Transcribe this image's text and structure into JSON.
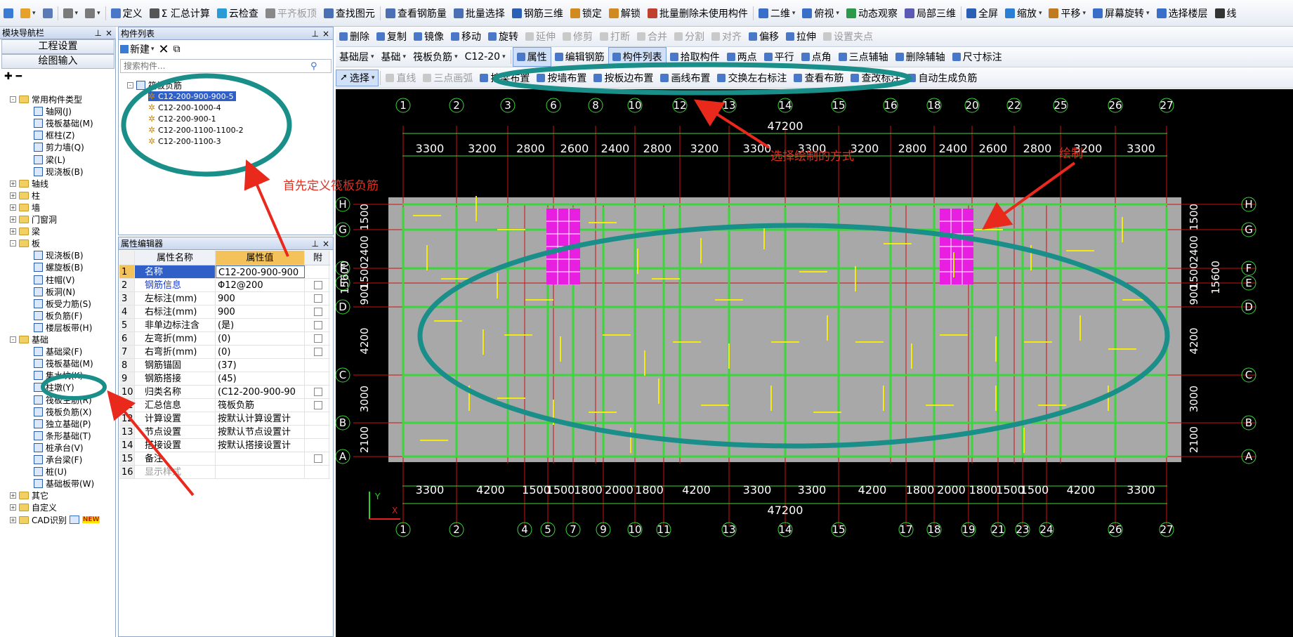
{
  "toolbar1": {
    "items": [
      {
        "icon": "new-icon",
        "label": ""
      },
      {
        "icon": "open-icon",
        "label": ""
      },
      {
        "icon": "save-icon",
        "label": ""
      },
      {
        "icon": "undo-icon",
        "label": ""
      },
      {
        "icon": "redo-icon",
        "label": ""
      },
      {
        "icon": "define-icon",
        "label": "定义"
      },
      {
        "icon": "sigma-icon",
        "label": "Σ 汇总计算"
      },
      {
        "icon": "cloud-icon",
        "label": "云检查"
      },
      {
        "icon": "align-slab-icon",
        "label": "平齐板顶"
      },
      {
        "icon": "find-icon",
        "label": "查找图元"
      },
      {
        "icon": "view-rebar-icon",
        "label": "查看钢筋量"
      },
      {
        "icon": "batch-select-icon",
        "label": "批量选择"
      },
      {
        "icon": "rebar-3d-icon",
        "label": "钢筋三维"
      },
      {
        "icon": "lock-icon",
        "label": "锁定"
      },
      {
        "icon": "unlock-icon",
        "label": "解锁"
      },
      {
        "icon": "batch-delete-icon",
        "label": "批量删除未使用构件"
      },
      {
        "icon": "2d-icon",
        "label": "二维"
      },
      {
        "icon": "top-view-icon",
        "label": "俯视"
      },
      {
        "icon": "dynamic-view-icon",
        "label": "动态观察"
      },
      {
        "icon": "local-3d-icon",
        "label": "局部三维"
      },
      {
        "icon": "fullscreen-icon",
        "label": "全屏"
      },
      {
        "icon": "zoom-icon",
        "label": "缩放"
      },
      {
        "icon": "pan-icon",
        "label": "平移"
      },
      {
        "icon": "rotate-screen-icon",
        "label": "屏幕旋转"
      },
      {
        "icon": "select-floor-icon",
        "label": "选择楼层"
      },
      {
        "icon": "line-icon",
        "label": "线"
      }
    ]
  },
  "nav": {
    "title": "模块导航栏",
    "pin": "ᵖ",
    "close": "×",
    "btn_project": "工程设置",
    "btn_draw": "绘图输入",
    "tree": [
      {
        "label": "常用构件类型",
        "level": 0,
        "expand": "-",
        "folder": true
      },
      {
        "label": "轴网(J)",
        "level": 1
      },
      {
        "label": "筏板基础(M)",
        "level": 1
      },
      {
        "label": "框柱(Z)",
        "level": 1
      },
      {
        "label": "剪力墙(Q)",
        "level": 1
      },
      {
        "label": "梁(L)",
        "level": 1
      },
      {
        "label": "现浇板(B)",
        "level": 1
      },
      {
        "label": "轴线",
        "level": 0,
        "expand": "+",
        "folder": true
      },
      {
        "label": "柱",
        "level": 0,
        "expand": "+",
        "folder": true
      },
      {
        "label": "墙",
        "level": 0,
        "expand": "+",
        "folder": true
      },
      {
        "label": "门窗洞",
        "level": 0,
        "expand": "+",
        "folder": true
      },
      {
        "label": "梁",
        "level": 0,
        "expand": "+",
        "folder": true
      },
      {
        "label": "板",
        "level": 0,
        "expand": "-",
        "folder": true
      },
      {
        "label": "现浇板(B)",
        "level": 1
      },
      {
        "label": "螺旋板(B)",
        "level": 1
      },
      {
        "label": "柱帽(V)",
        "level": 1
      },
      {
        "label": "板洞(N)",
        "level": 1
      },
      {
        "label": "板受力筋(S)",
        "level": 1
      },
      {
        "label": "板负筋(F)",
        "level": 1
      },
      {
        "label": "楼层板带(H)",
        "level": 1
      },
      {
        "label": "基础",
        "level": 0,
        "expand": "-",
        "folder": true
      },
      {
        "label": "基础梁(F)",
        "level": 1
      },
      {
        "label": "筏板基础(M)",
        "level": 1
      },
      {
        "label": "集水坑(K)",
        "level": 1
      },
      {
        "label": "柱墩(Y)",
        "level": 1
      },
      {
        "label": "筏板主筋(R)",
        "level": 1
      },
      {
        "label": "筏板负筋(X)",
        "level": 1
      },
      {
        "label": "独立基础(P)",
        "level": 1
      },
      {
        "label": "条形基础(T)",
        "level": 1
      },
      {
        "label": "桩承台(V)",
        "level": 1
      },
      {
        "label": "承台梁(F)",
        "level": 1
      },
      {
        "label": "桩(U)",
        "level": 1
      },
      {
        "label": "基础板带(W)",
        "level": 1
      },
      {
        "label": "其它",
        "level": 0,
        "expand": "+",
        "folder": true
      },
      {
        "label": "自定义",
        "level": 0,
        "expand": "+",
        "folder": true
      },
      {
        "label": "CAD识别",
        "level": 0,
        "expand": "+",
        "folder": true,
        "badge": "NEW"
      }
    ]
  },
  "complist": {
    "title": "构件列表",
    "new_label": "新建",
    "search_placeholder": "搜索构件...",
    "root": "筏板负筋",
    "items": [
      "C12-200-900-900-5",
      "C12-200-1000-4",
      "C12-200-900-1",
      "C12-200-1100-1100-2",
      "C12-200-1100-3"
    ],
    "selected_index": 0
  },
  "props": {
    "title": "属性编辑器",
    "col_name": "属性名称",
    "col_value": "属性值",
    "col_extra": "附",
    "rows": [
      {
        "no": "1",
        "name": "名称",
        "value": "C12-200-900-900",
        "blue": true,
        "cb": false
      },
      {
        "no": "2",
        "name": "钢筋信息",
        "value": "Φ12@200",
        "blue": true,
        "cb": true
      },
      {
        "no": "3",
        "name": "左标注(mm)",
        "value": "900",
        "blue": false,
        "cb": true
      },
      {
        "no": "4",
        "name": "右标注(mm)",
        "value": "900",
        "blue": false,
        "cb": true
      },
      {
        "no": "5",
        "name": "非单边标注含",
        "value": "(是)",
        "blue": false,
        "cb": true
      },
      {
        "no": "6",
        "name": "左弯折(mm)",
        "value": "(0)",
        "blue": false,
        "cb": true
      },
      {
        "no": "7",
        "name": "右弯折(mm)",
        "value": "(0)",
        "blue": false,
        "cb": true
      },
      {
        "no": "8",
        "name": "钢筋锚固",
        "value": "(37)",
        "blue": false,
        "cb": false
      },
      {
        "no": "9",
        "name": "钢筋搭接",
        "value": "(45)",
        "blue": false,
        "cb": false
      },
      {
        "no": "10",
        "name": "归类名称",
        "value": "(C12-200-900-90",
        "blue": false,
        "cb": true
      },
      {
        "no": "11",
        "name": "汇总信息",
        "value": "筏板负筋",
        "blue": false,
        "cb": true
      },
      {
        "no": "12",
        "name": "计算设置",
        "value": "按默认计算设置计",
        "blue": false,
        "cb": false
      },
      {
        "no": "13",
        "name": "节点设置",
        "value": "按默认节点设置计",
        "blue": false,
        "cb": false
      },
      {
        "no": "14",
        "name": "搭接设置",
        "value": "按默认搭接设置计",
        "blue": false,
        "cb": false
      },
      {
        "no": "15",
        "name": "备注",
        "value": "",
        "blue": false,
        "cb": true
      },
      {
        "no": "16",
        "name": "显示样式",
        "value": "",
        "blue": false,
        "cb": false,
        "gray": true
      }
    ]
  },
  "toolbar2": {
    "items": [
      "删除",
      "复制",
      "镜像",
      "移动",
      "旋转",
      "延伸",
      "修剪",
      "打断",
      "合并",
      "分割",
      "对齐",
      "偏移",
      "拉伸",
      "设置夹点"
    ],
    "disabled": [
      "延伸",
      "修剪",
      "打断",
      "合并",
      "分割",
      "对齐",
      "设置夹点"
    ]
  },
  "toolbar3": {
    "layer": "基础层",
    "category": "基础",
    "type": "筏板负筋",
    "component": "C12-20",
    "items": [
      "属性",
      "编辑钢筋",
      "构件列表",
      "拾取构件",
      "两点",
      "平行",
      "点角",
      "三点辅轴",
      "删除辅轴",
      "尺寸标注"
    ]
  },
  "toolbar4": {
    "select": "选择",
    "items": [
      "直线",
      "三点画弧",
      "按梁布置",
      "按墙布置",
      "按板边布置",
      "画线布置",
      "交换左右标注",
      "查看布筋",
      "查改标注",
      "自动生成负筋"
    ],
    "disabled": [
      "直线",
      "三点画弧"
    ]
  },
  "annotations": {
    "define_first": "首先定义筏板负筋",
    "choose_method": "选择绘制的方式",
    "draw": "绘制"
  },
  "cad": {
    "top_axes": [
      "1",
      "2",
      "3",
      "6",
      "8",
      "10",
      "12",
      "13",
      "14",
      "15",
      "16",
      "18",
      "20",
      "22",
      "25",
      "26",
      "27"
    ],
    "bottom_axes": [
      "1",
      "2",
      "4",
      "5",
      "7",
      "9",
      "10",
      "11",
      "13",
      "14",
      "15",
      "17",
      "18",
      "19",
      "21",
      "23",
      "24",
      "26",
      "27"
    ],
    "row_axes": [
      "H",
      "G",
      "F",
      "E",
      "D",
      "C",
      "B",
      "A"
    ],
    "top_total": "47200",
    "top_dims": [
      "3300",
      "3200",
      "2800",
      "2600",
      "2400",
      "2800",
      "3200",
      "3300",
      "3300",
      "3200",
      "2800",
      "2400",
      "2600",
      "2800",
      "3200",
      "3300"
    ],
    "bottom_dims": [
      "3300",
      "4200",
      "1500",
      "1500",
      "1800",
      "2000",
      "1800",
      "4200",
      "3300",
      "3300",
      "4200",
      "1800",
      "2000",
      "1800",
      "1500",
      "1500",
      "4200",
      "3300"
    ],
    "bottom_total": "47200",
    "left_dims": [
      "1500",
      "2400",
      "1500",
      "900",
      "4200",
      "3000",
      "2100"
    ],
    "left_total": "15600",
    "right_dims": [
      "1500",
      "2400",
      "1500",
      "900",
      "4200",
      "3000",
      "2100"
    ],
    "right_total": "15600",
    "ucs_y": "Y",
    "ucs_x": "X"
  }
}
